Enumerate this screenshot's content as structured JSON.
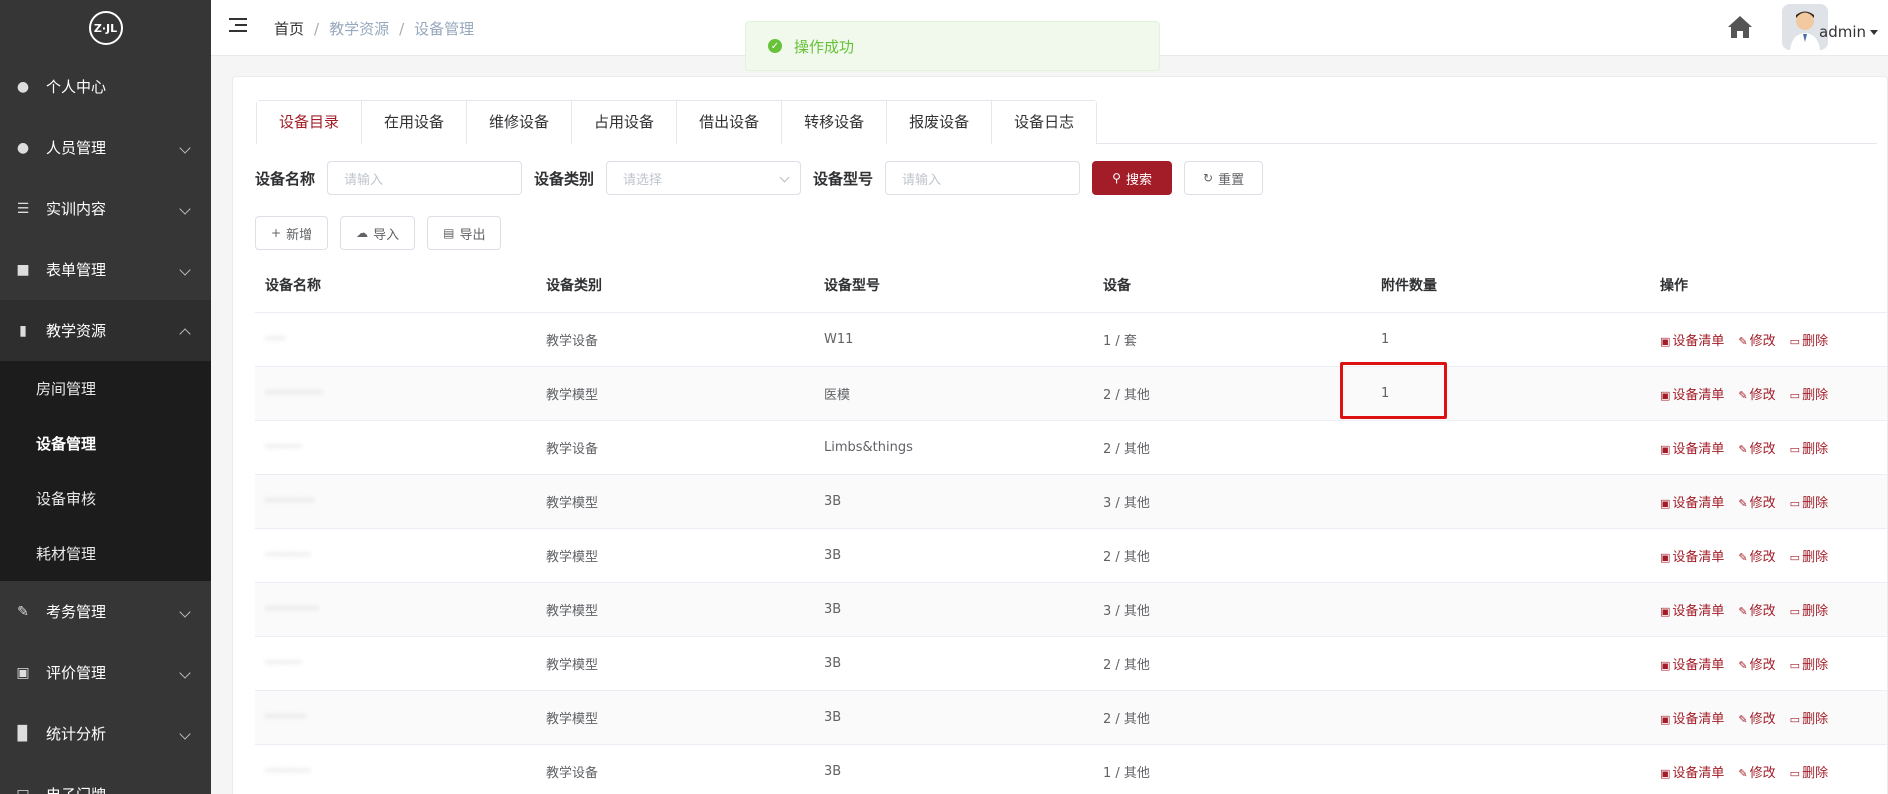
{
  "logo": {
    "text": "Z·JL"
  },
  "sidebar": {
    "items": [
      {
        "label": "个人中心",
        "icon": "user-icon"
      },
      {
        "label": "人员管理",
        "icon": "users-icon"
      },
      {
        "label": "实训内容",
        "icon": "list-icon"
      },
      {
        "label": "表单管理",
        "icon": "form-icon"
      },
      {
        "label": "教学资源",
        "icon": "book-icon"
      },
      {
        "label": "考务管理",
        "icon": "edit-icon"
      },
      {
        "label": "评价管理",
        "icon": "image-icon"
      },
      {
        "label": "统计分析",
        "icon": "chart-icon"
      },
      {
        "label": "电子门牌",
        "icon": "door-icon"
      }
    ],
    "submenu": [
      {
        "label": "房间管理"
      },
      {
        "label": "设备管理"
      },
      {
        "label": "设备审核"
      },
      {
        "label": "耗材管理"
      }
    ]
  },
  "breadcrumb": {
    "home": "首页",
    "level1": "教学资源",
    "level2": "设备管理"
  },
  "user": {
    "name": "admin"
  },
  "toast": {
    "message": "操作成功"
  },
  "tabs": [
    {
      "label": "设备目录"
    },
    {
      "label": "在用设备"
    },
    {
      "label": "维修设备"
    },
    {
      "label": "占用设备"
    },
    {
      "label": "借出设备"
    },
    {
      "label": "转移设备"
    },
    {
      "label": "报废设备"
    },
    {
      "label": "设备日志"
    }
  ],
  "filters": {
    "name_label": "设备名称",
    "name_placeholder": "请输入",
    "category_label": "设备类别",
    "category_placeholder": "请选择",
    "model_label": "设备型号",
    "model_placeholder": "请输入",
    "search_label": "搜索",
    "reset_label": "重置"
  },
  "actions": {
    "add_label": "新增",
    "import_label": "导入",
    "export_label": "导出"
  },
  "table": {
    "headers": [
      "设备名称",
      "设备类别",
      "设备型号",
      "设备",
      "附件数量",
      "操作"
    ],
    "op_labels": {
      "list": "设备清单",
      "edit": "修改",
      "delete": "删除"
    },
    "rows": [
      {
        "name": "·····",
        "category": "教学设备",
        "model": "W11",
        "device": "1 / 套",
        "attachments": "1"
      },
      {
        "name": "··············",
        "category": "教学模型",
        "model": "医模",
        "device": "2 / 其他",
        "attachments": "1"
      },
      {
        "name": "·········",
        "category": "教学设备",
        "model": "Limbs&things",
        "device": "2 / 其他",
        "attachments": ""
      },
      {
        "name": "············",
        "category": "教学模型",
        "model": "3B",
        "device": "3 / 其他",
        "attachments": ""
      },
      {
        "name": "···········",
        "category": "教学模型",
        "model": "3B",
        "device": "2 / 其他",
        "attachments": ""
      },
      {
        "name": "·············",
        "category": "教学模型",
        "model": "3B",
        "device": "3 / 其他",
        "attachments": ""
      },
      {
        "name": "·········",
        "category": "教学模型",
        "model": "3B",
        "device": "2 / 其他",
        "attachments": ""
      },
      {
        "name": "··········",
        "category": "教学模型",
        "model": "3B",
        "device": "2 / 其他",
        "attachments": ""
      },
      {
        "name": "···········",
        "category": "教学设备",
        "model": "3B",
        "device": "1 / 其他",
        "attachments": ""
      }
    ]
  },
  "colors": {
    "brand": "#a31d28",
    "sidebar": "#363636",
    "success": "#67c23a"
  }
}
